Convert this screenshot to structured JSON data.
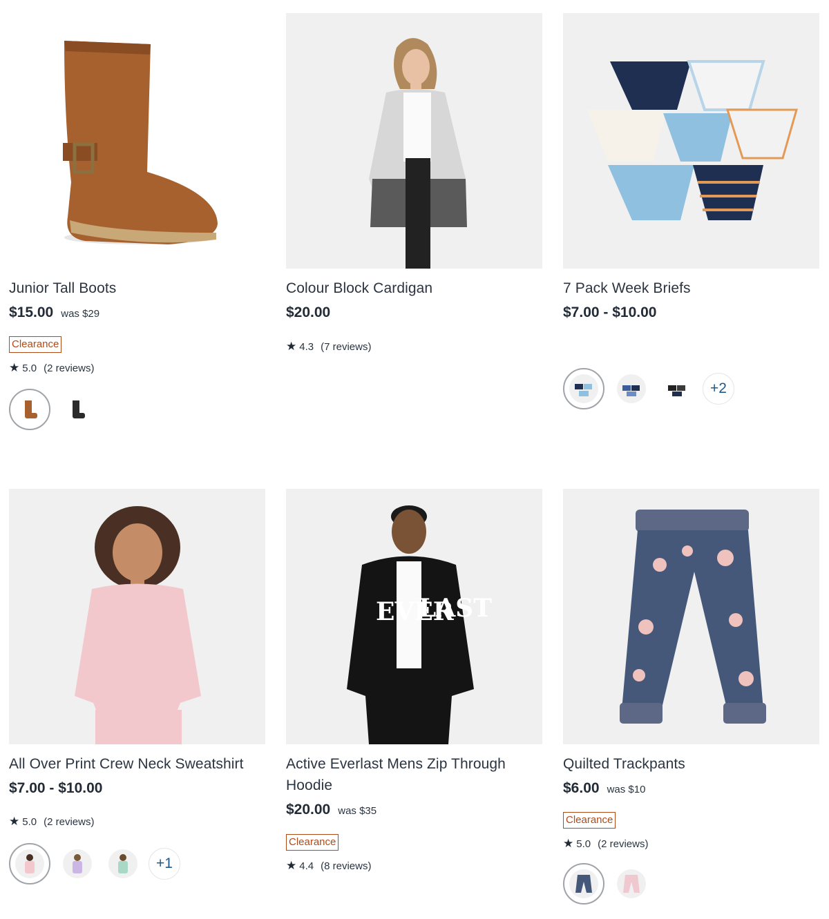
{
  "products": [
    {
      "name": "Junior Tall Boots",
      "price": "$15.00",
      "was": "was $29",
      "badge": "Clearance",
      "rating": "5.0",
      "reviews": "(2 reviews)",
      "swatches": [
        "tan-boot",
        "black-boot"
      ]
    },
    {
      "name": "Colour Block Cardigan",
      "price": "$20.00",
      "rating": "4.3",
      "reviews": "(7 reviews)"
    },
    {
      "name": "7 Pack Week Briefs",
      "price": "$7.00 - $10.00",
      "swatches": [
        "blue-briefs",
        "navy-briefs",
        "dark-briefs"
      ],
      "more": "+2"
    },
    {
      "name": "All Over Print Crew Neck Sweatshirt",
      "price": "$7.00 - $10.00",
      "rating": "5.0",
      "reviews": "(2 reviews)",
      "swatches": [
        "pink-sweatshirt",
        "lilac-sweatshirt",
        "mint-sweatshirt"
      ],
      "more": "+1"
    },
    {
      "name_line1": "Active Everlast Mens Zip Through",
      "name_line2": "Hoodie",
      "price": "$20.00",
      "was": "was $35",
      "badge": "Clearance",
      "rating": "4.4",
      "reviews": "(8 reviews)"
    },
    {
      "name": "Quilted Trackpants",
      "price": "$6.00",
      "was": "was $10",
      "badge": "Clearance",
      "rating": "5.0",
      "reviews": "(2 reviews)",
      "swatches": [
        "navy-floral-pants",
        "pink-floral-pants"
      ]
    }
  ],
  "icons": {
    "rating": "star-icon"
  },
  "colors": {
    "clearance": "#b04a17",
    "more_link": "#1d5a8e",
    "text": "#2b3441"
  }
}
